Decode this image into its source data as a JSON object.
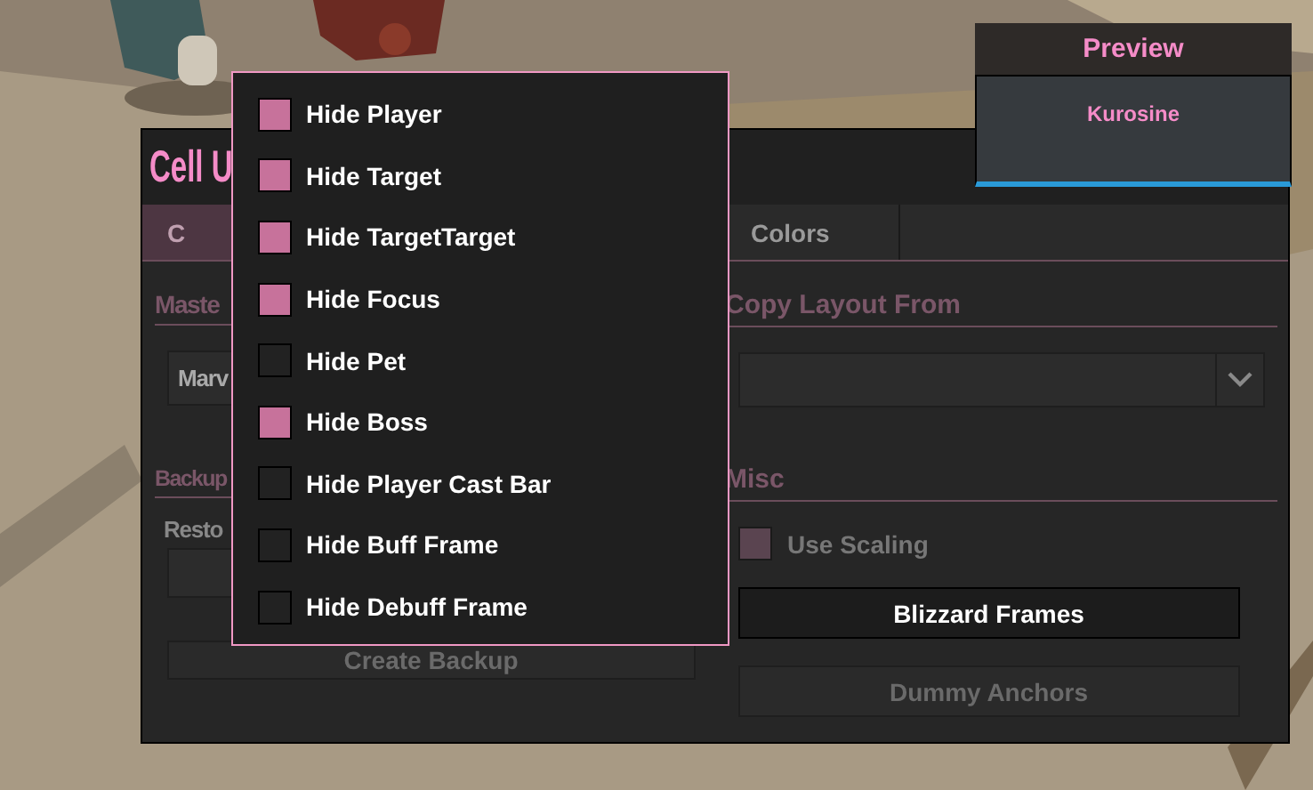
{
  "main_window": {
    "title": "Cell U",
    "tabs": [
      {
        "label": "C",
        "selected": true
      },
      {
        "label": "Colors",
        "selected": false
      }
    ],
    "left": {
      "layout_heading": "Maste",
      "layout_value": "Marv",
      "backups_heading": "Backup",
      "restore_label": "Resto",
      "create_button": {
        "label": "Create Backup",
        "disabled": true
      }
    },
    "right": {
      "copy_heading": "Copy Layout From",
      "misc_heading": "Misc",
      "use_scaling": {
        "label": "Use Scaling",
        "checked": true,
        "disabled": true
      },
      "buttons": [
        {
          "label": "Blizzard Frames",
          "disabled": false
        },
        {
          "label": "Dummy Anchors",
          "disabled": true
        }
      ]
    }
  },
  "preview": {
    "title": "Preview",
    "name": "Kurosine"
  },
  "menu": {
    "items": [
      {
        "label": "Hide Player",
        "checked": true
      },
      {
        "label": "Hide Target",
        "checked": true
      },
      {
        "label": "Hide TargetTarget",
        "checked": true
      },
      {
        "label": "Hide Focus",
        "checked": true
      },
      {
        "label": "Hide Pet",
        "checked": false
      },
      {
        "label": "Hide Boss",
        "checked": true
      },
      {
        "label": "Hide Player Cast Bar",
        "checked": false
      },
      {
        "label": "Hide Buff Frame",
        "checked": false
      },
      {
        "label": "Hide Debuff Frame",
        "checked": false
      }
    ]
  }
}
